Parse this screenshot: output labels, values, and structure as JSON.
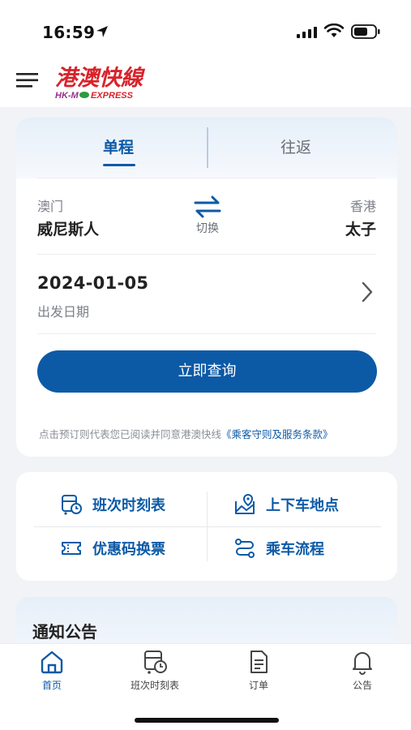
{
  "status_bar": {
    "time": "16:59"
  },
  "header": {
    "logo_text": "港澳快線",
    "logo_subtext": "HK-MO EXPRESS"
  },
  "search": {
    "tabs": [
      {
        "label": "单程",
        "active": true
      },
      {
        "label": "往返",
        "active": false
      }
    ],
    "from": {
      "region": "澳门",
      "station": "威尼斯人"
    },
    "to": {
      "region": "香港",
      "station": "太子"
    },
    "swap_label": "切换",
    "date": {
      "value": "2024-01-05",
      "label": "出发日期"
    },
    "query_button": "立即查询",
    "terms_prefix": "点击预订则代表您已阅读并同意港澳快线",
    "terms_link": "《乘客守则及服务条款》"
  },
  "quick_links": [
    {
      "label": "班次时刻表",
      "icon": "bus-clock-icon"
    },
    {
      "label": "上下车地点",
      "icon": "map-pin-icon"
    },
    {
      "label": "优惠码换票",
      "icon": "ticket-icon"
    },
    {
      "label": "乘车流程",
      "icon": "route-icon"
    }
  ],
  "notice": {
    "title": "通知公告"
  },
  "bottom_nav": [
    {
      "label": "首页",
      "icon": "home-icon",
      "active": true
    },
    {
      "label": "班次时刻表",
      "icon": "bus-clock-icon",
      "active": false
    },
    {
      "label": "订单",
      "icon": "document-icon",
      "active": false
    },
    {
      "label": "公告",
      "icon": "bell-icon",
      "active": false
    }
  ],
  "colors": {
    "primary": "#0c5aa6",
    "logo_red": "#d8232a",
    "logo_green": "#2e9b3f"
  }
}
